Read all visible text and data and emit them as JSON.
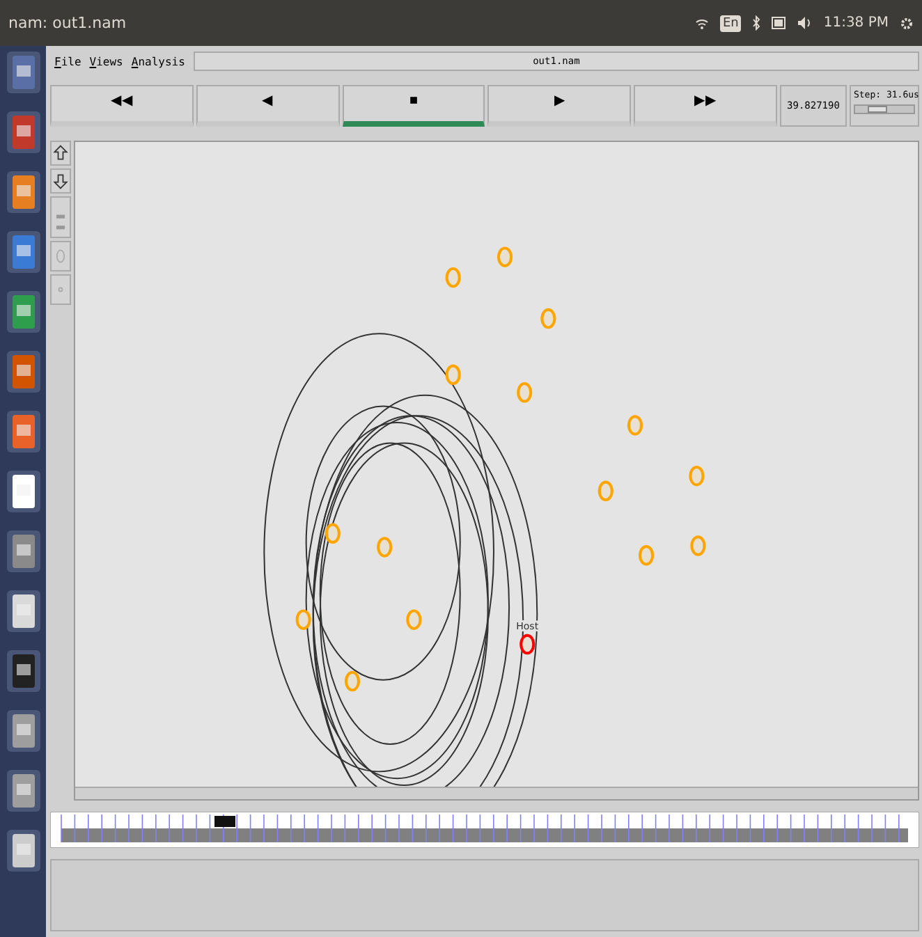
{
  "top_bar": {
    "title": "nam: out1.nam",
    "keyboard": "En",
    "clock": "11:38 PM"
  },
  "menu": [
    {
      "label": "File"
    },
    {
      "label": "Views"
    },
    {
      "label": "Analysis"
    }
  ],
  "file_name": "out1.nam",
  "controls": [
    {
      "glyph": "◀◀",
      "selected": false
    },
    {
      "glyph": "◀",
      "selected": false
    },
    {
      "glyph": "■",
      "selected": true
    },
    {
      "glyph": "▶",
      "selected": false
    },
    {
      "glyph": "▶▶",
      "selected": false
    }
  ],
  "time": "39.827190",
  "step": {
    "label": "Step: 31.6us",
    "level": 0.3
  },
  "nodes": [
    {
      "color": "#ffa500"
    },
    {
      "color": "#ffa500"
    },
    {
      "color": "#ffa500"
    },
    {
      "color": "#ffa500"
    },
    {
      "color": "#ffa500"
    },
    {
      "color": "#ffa500"
    },
    {
      "color": "#ffa500"
    },
    {
      "color": "#ffa500"
    },
    {
      "color": "#ffa500"
    },
    {
      "color": "#ffa500"
    },
    {
      "color": "#ffa500"
    },
    {
      "color": "#ffa500"
    },
    {
      "color": "#ffa500"
    },
    {
      "color": "#ffa500"
    },
    {
      "color": "#ffa500"
    },
    {
      "color": "#ff0000",
      "label": "Host"
    }
  ]
}
